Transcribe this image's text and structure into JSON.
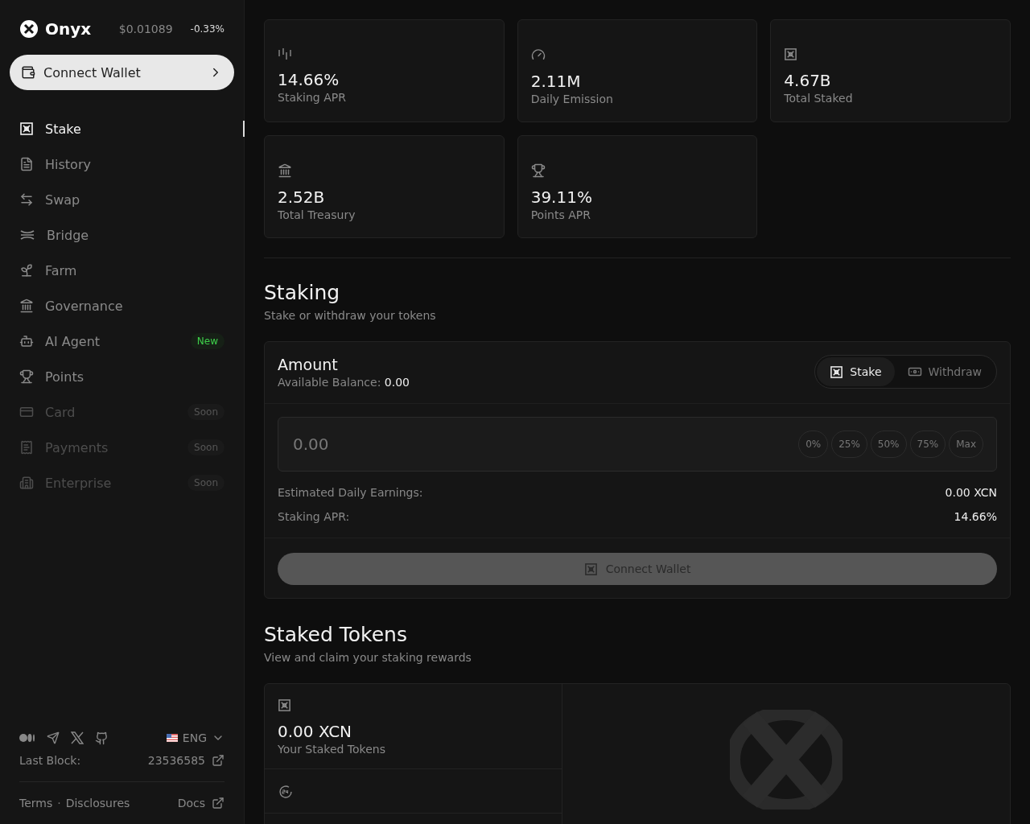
{
  "brand": {
    "name": "Onyx",
    "price": "$0.01089",
    "change": "-0.33%"
  },
  "connect_wallet": "Connect Wallet",
  "nav": [
    {
      "label": "Stake",
      "selected": true,
      "disabled": false
    },
    {
      "label": "History",
      "selected": false,
      "disabled": false
    },
    {
      "label": "Swap",
      "selected": false,
      "disabled": false
    },
    {
      "label": "Bridge",
      "selected": false,
      "disabled": false
    },
    {
      "label": "Farm",
      "selected": false,
      "disabled": false
    },
    {
      "label": "Governance",
      "selected": false,
      "disabled": false
    },
    {
      "label": "AI Agent",
      "selected": false,
      "disabled": false,
      "badge": "New"
    },
    {
      "label": "Points",
      "selected": false,
      "disabled": false
    },
    {
      "label": "Card",
      "selected": false,
      "disabled": true,
      "badge": "Soon"
    },
    {
      "label": "Payments",
      "selected": false,
      "disabled": true,
      "badge": "Soon"
    },
    {
      "label": "Enterprise",
      "selected": false,
      "disabled": true,
      "badge": "Soon"
    }
  ],
  "footer": {
    "language": "ENG",
    "last_block_label": "Last Block:",
    "last_block": "23536585",
    "links": [
      "Terms",
      "Disclosures"
    ],
    "separator": "·",
    "docs": "Docs"
  },
  "stats": [
    {
      "value": "14.66%",
      "label": "Staking APR"
    },
    {
      "value": "2.11M",
      "label": "Daily Emission"
    },
    {
      "value": "4.67B",
      "label": "Total Staked"
    },
    {
      "value": "2.52B",
      "label": "Total Treasury"
    },
    {
      "value": "39.11%",
      "label": "Points APR"
    }
  ],
  "staking": {
    "title": "Staking",
    "subtitle": "Stake or withdraw your tokens",
    "amount_title": "Amount",
    "balance_label": "Available Balance:",
    "balance": "0.00",
    "tabs": [
      {
        "label": "Stake",
        "selected": true
      },
      {
        "label": "Withdraw",
        "selected": false
      }
    ],
    "placeholder": "0.00",
    "presets": [
      "0%",
      "25%",
      "50%",
      "75%",
      "Max"
    ],
    "details": [
      {
        "label": "Estimated Daily Earnings:",
        "value": "0.00 XCN"
      },
      {
        "label": "Staking APR:",
        "value": "14.66%"
      }
    ],
    "button": "Connect Wallet"
  },
  "staked": {
    "title": "Staked Tokens",
    "subtitle": "View and claim your staking rewards",
    "items": [
      {
        "value": "0.00 XCN",
        "label": "Your Staked Tokens"
      }
    ]
  }
}
